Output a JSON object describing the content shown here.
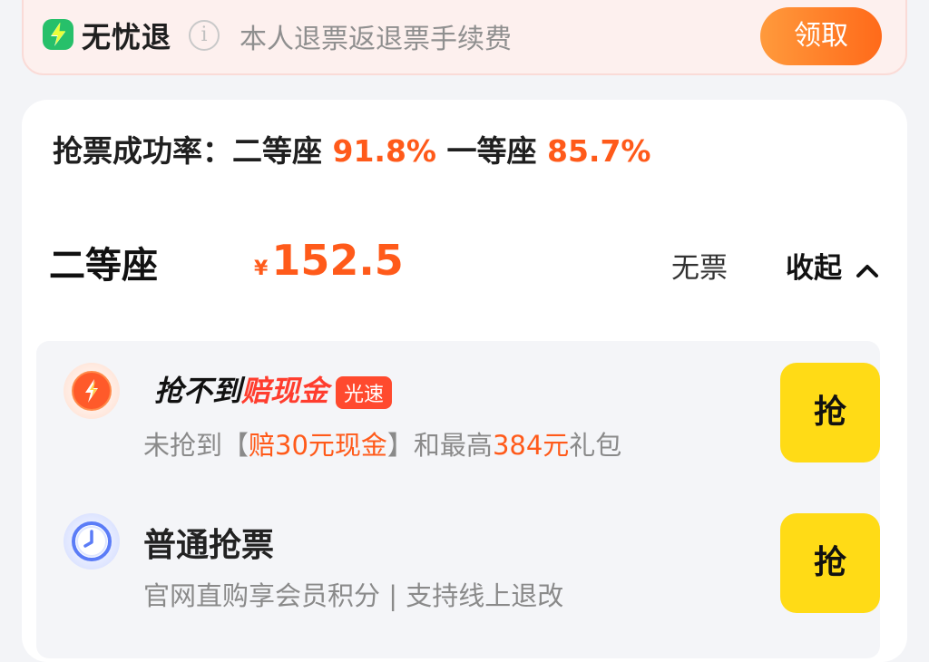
{
  "banner": {
    "title": "无忧退",
    "description": "本人退票返退票手续费",
    "claim_label": "领取",
    "accent": "#ff6a1a"
  },
  "success_rate": {
    "label": "抢票成功率：",
    "second_class_label": "二等座",
    "second_class_rate": "91.8%",
    "first_class_label": "一等座",
    "first_class_rate": "85.7%"
  },
  "seat": {
    "name": "二等座",
    "currency": "¥",
    "price": "152.5",
    "availability": "无票",
    "collapse_label": "收起"
  },
  "options": [
    {
      "title_prefix": "抢不到",
      "title_highlight": "赔现金",
      "badge": "光速",
      "sub_prefix": "未抢到【",
      "sub_highlight1": "赔30元现金",
      "sub_mid": "】和最高",
      "sub_highlight2": "384元",
      "sub_suffix": "礼包",
      "button": "抢",
      "icon": "lightning-icon"
    },
    {
      "title": "普通抢票",
      "subtitle": "官网直购享会员积分 | 支持线上退改",
      "button": "抢",
      "icon": "clock-icon"
    }
  ],
  "colors": {
    "orange": "#ff5a1a",
    "red": "#ff3d2e",
    "yellow_button": "#ffdb16"
  }
}
